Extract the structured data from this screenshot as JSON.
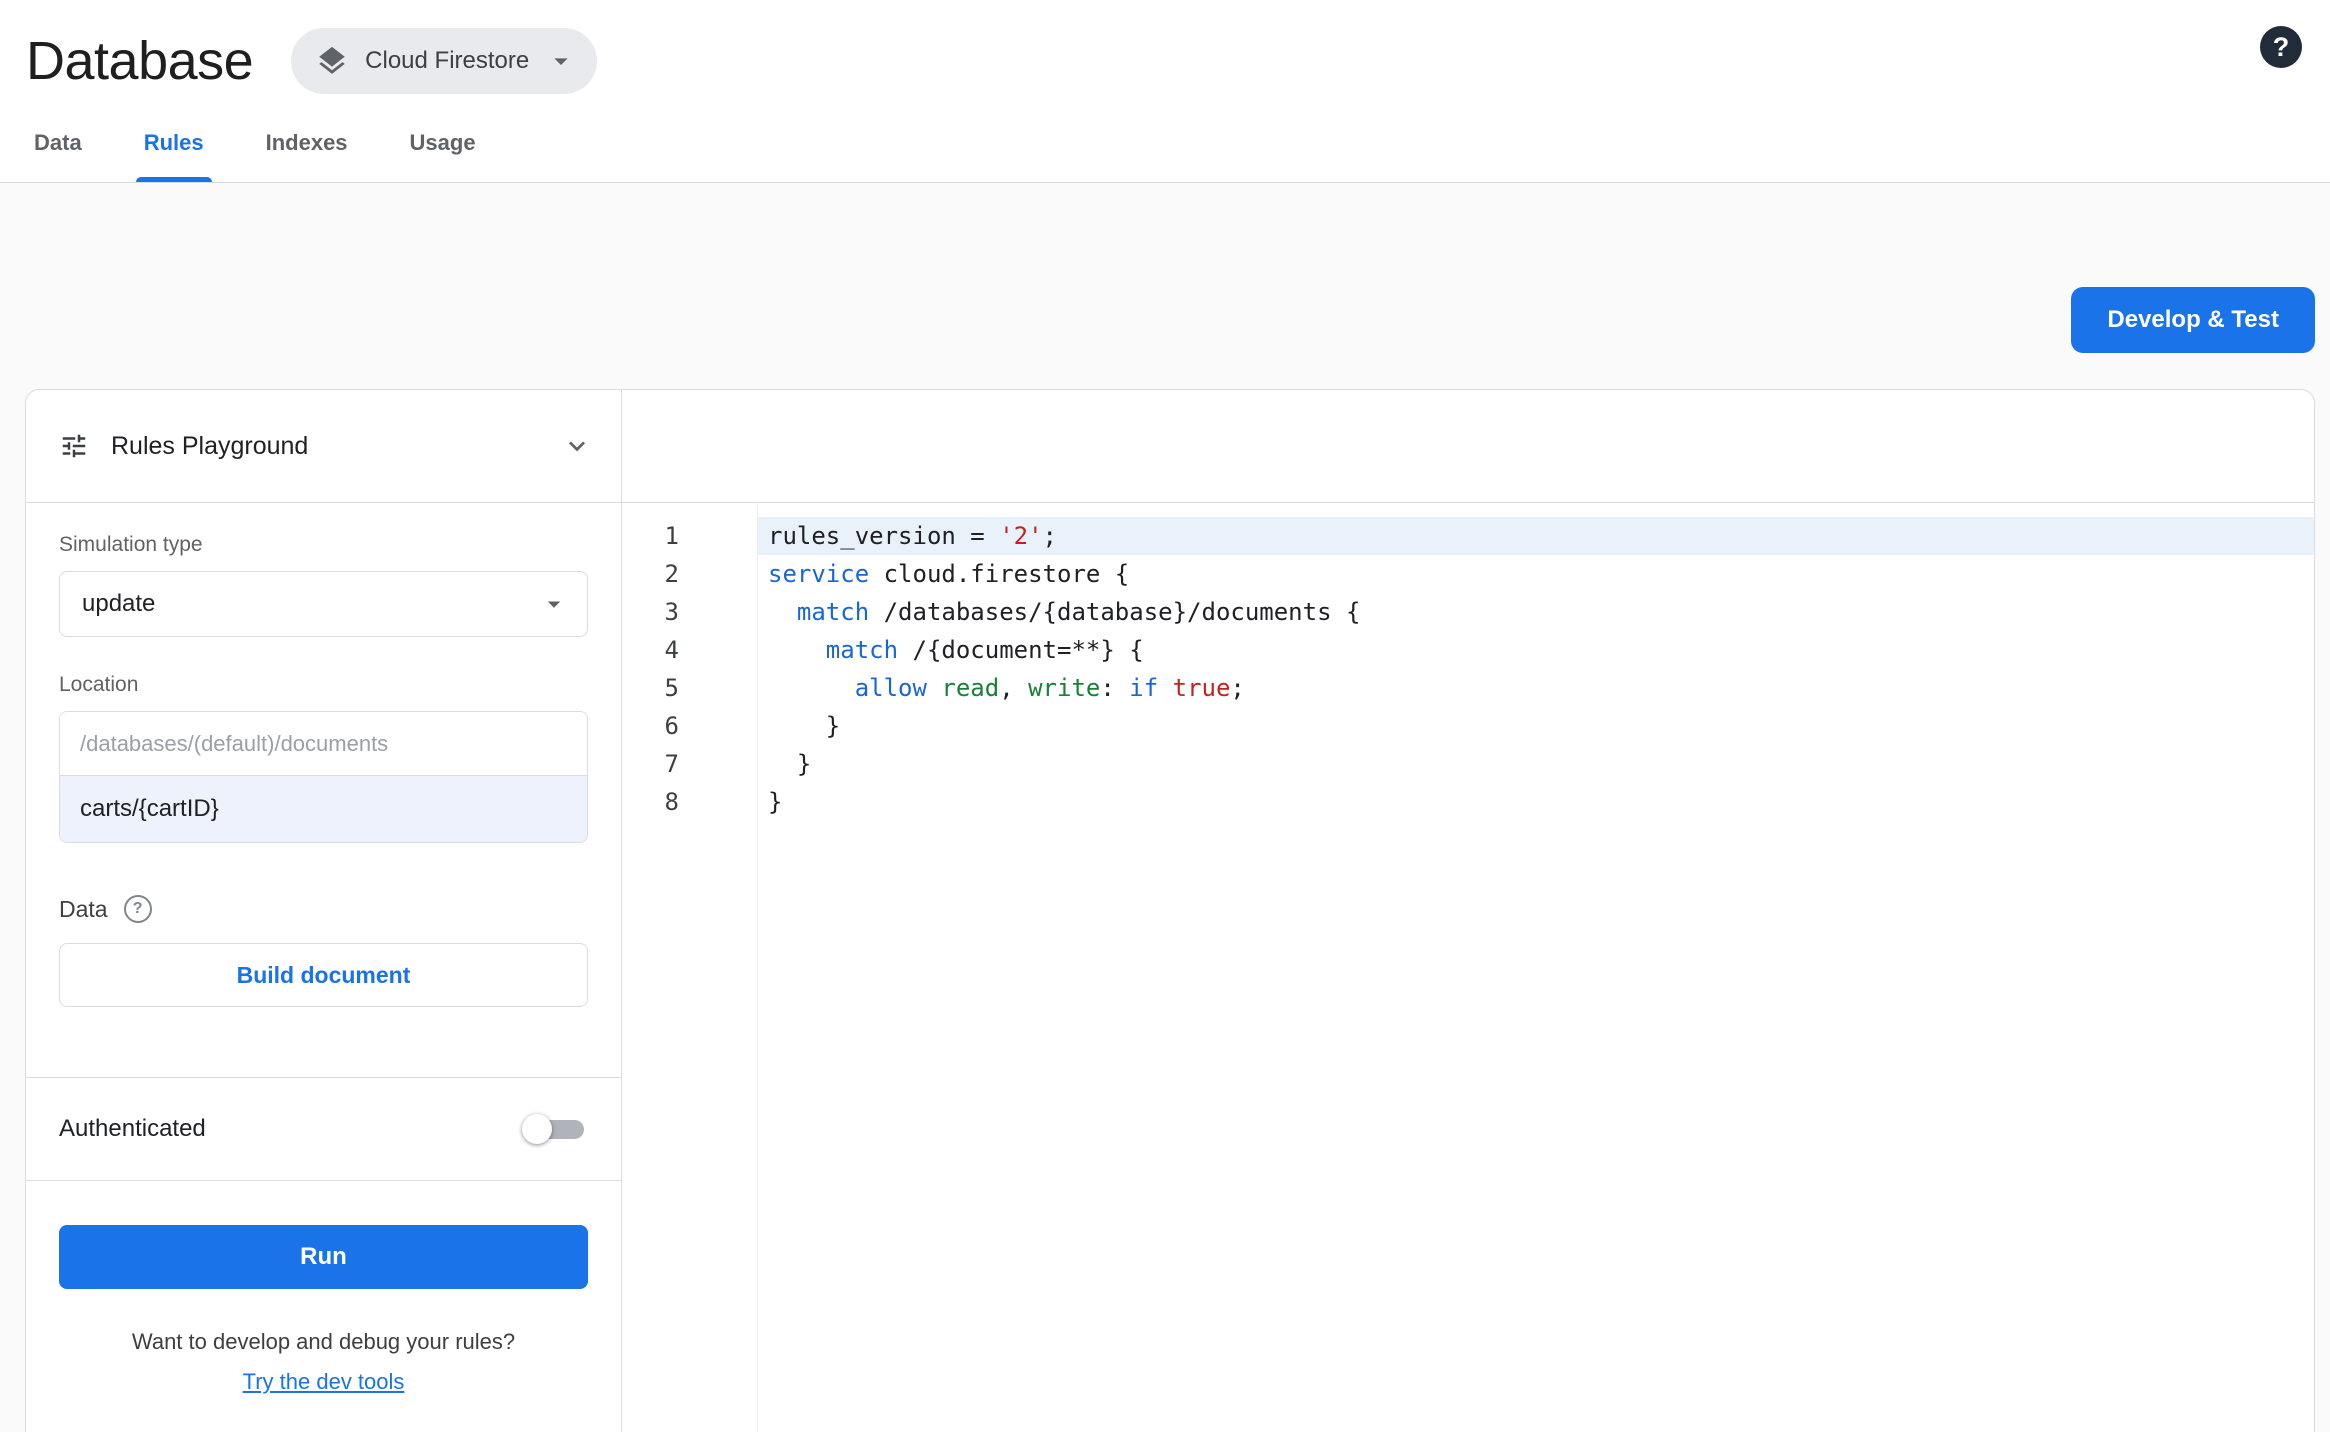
{
  "colors": {
    "accent": "#1a73e8",
    "pill_bg": "#e8eaed",
    "border": "#dadce0",
    "active_line_bg": "#e9f1fb",
    "location_value_bg": "#edf2fc",
    "code_keyword": "#1967d2",
    "code_string": "#c5221f",
    "code_permission": "#188038",
    "code_plain": "#202124"
  },
  "header": {
    "title": "Database",
    "product_selector": {
      "label": "Cloud Firestore"
    },
    "help": "?"
  },
  "tabs": [
    {
      "label": "Data"
    },
    {
      "label": "Rules"
    },
    {
      "label": "Indexes"
    },
    {
      "label": "Usage"
    }
  ],
  "toolbar": {
    "develop_test_label": "Develop & Test"
  },
  "playground": {
    "title": "Rules Playground",
    "simulation_type_label": "Simulation type",
    "simulation_type_value": "update",
    "location_label": "Location",
    "location_prefix": "/databases/(default)/documents",
    "location_value": "carts/{cartID}",
    "data_label": "Data",
    "data_help": "?",
    "build_document_label": "Build document",
    "authenticated_label": "Authenticated",
    "authenticated_enabled": false,
    "run_label": "Run",
    "footer_text": "Want to develop and debug your rules?",
    "footer_link": "Try the dev tools"
  },
  "editor": {
    "lines": [
      {
        "number": 1,
        "active": true,
        "tokens": [
          {
            "t": "rules_version = ",
            "y": "plain"
          },
          {
            "t": "'2'",
            "y": "string"
          },
          {
            "t": ";",
            "y": "plain"
          }
        ]
      },
      {
        "number": 2,
        "tokens": [
          {
            "t": "service",
            "y": "keyword"
          },
          {
            "t": " cloud.firestore {",
            "y": "plain"
          }
        ]
      },
      {
        "number": 3,
        "tokens": [
          {
            "t": "  ",
            "y": "plain"
          },
          {
            "t": "match",
            "y": "keyword"
          },
          {
            "t": " /databases/{database}/documents {",
            "y": "plain"
          }
        ]
      },
      {
        "number": 4,
        "tokens": [
          {
            "t": "    ",
            "y": "plain"
          },
          {
            "t": "match",
            "y": "keyword"
          },
          {
            "t": " /{document=**} {",
            "y": "plain"
          }
        ]
      },
      {
        "number": 5,
        "tokens": [
          {
            "t": "      ",
            "y": "plain"
          },
          {
            "t": "allow",
            "y": "keyword"
          },
          {
            "t": " ",
            "y": "plain"
          },
          {
            "t": "read",
            "y": "permission"
          },
          {
            "t": ", ",
            "y": "plain"
          },
          {
            "t": "write",
            "y": "permission"
          },
          {
            "t": ": ",
            "y": "plain"
          },
          {
            "t": "if",
            "y": "keyword"
          },
          {
            "t": " ",
            "y": "plain"
          },
          {
            "t": "true",
            "y": "string"
          },
          {
            "t": ";",
            "y": "plain"
          }
        ]
      },
      {
        "number": 6,
        "tokens": [
          {
            "t": "    }",
            "y": "plain"
          }
        ]
      },
      {
        "number": 7,
        "tokens": [
          {
            "t": "  }",
            "y": "plain"
          }
        ]
      },
      {
        "number": 8,
        "tokens": [
          {
            "t": "}",
            "y": "plain"
          }
        ]
      }
    ]
  }
}
